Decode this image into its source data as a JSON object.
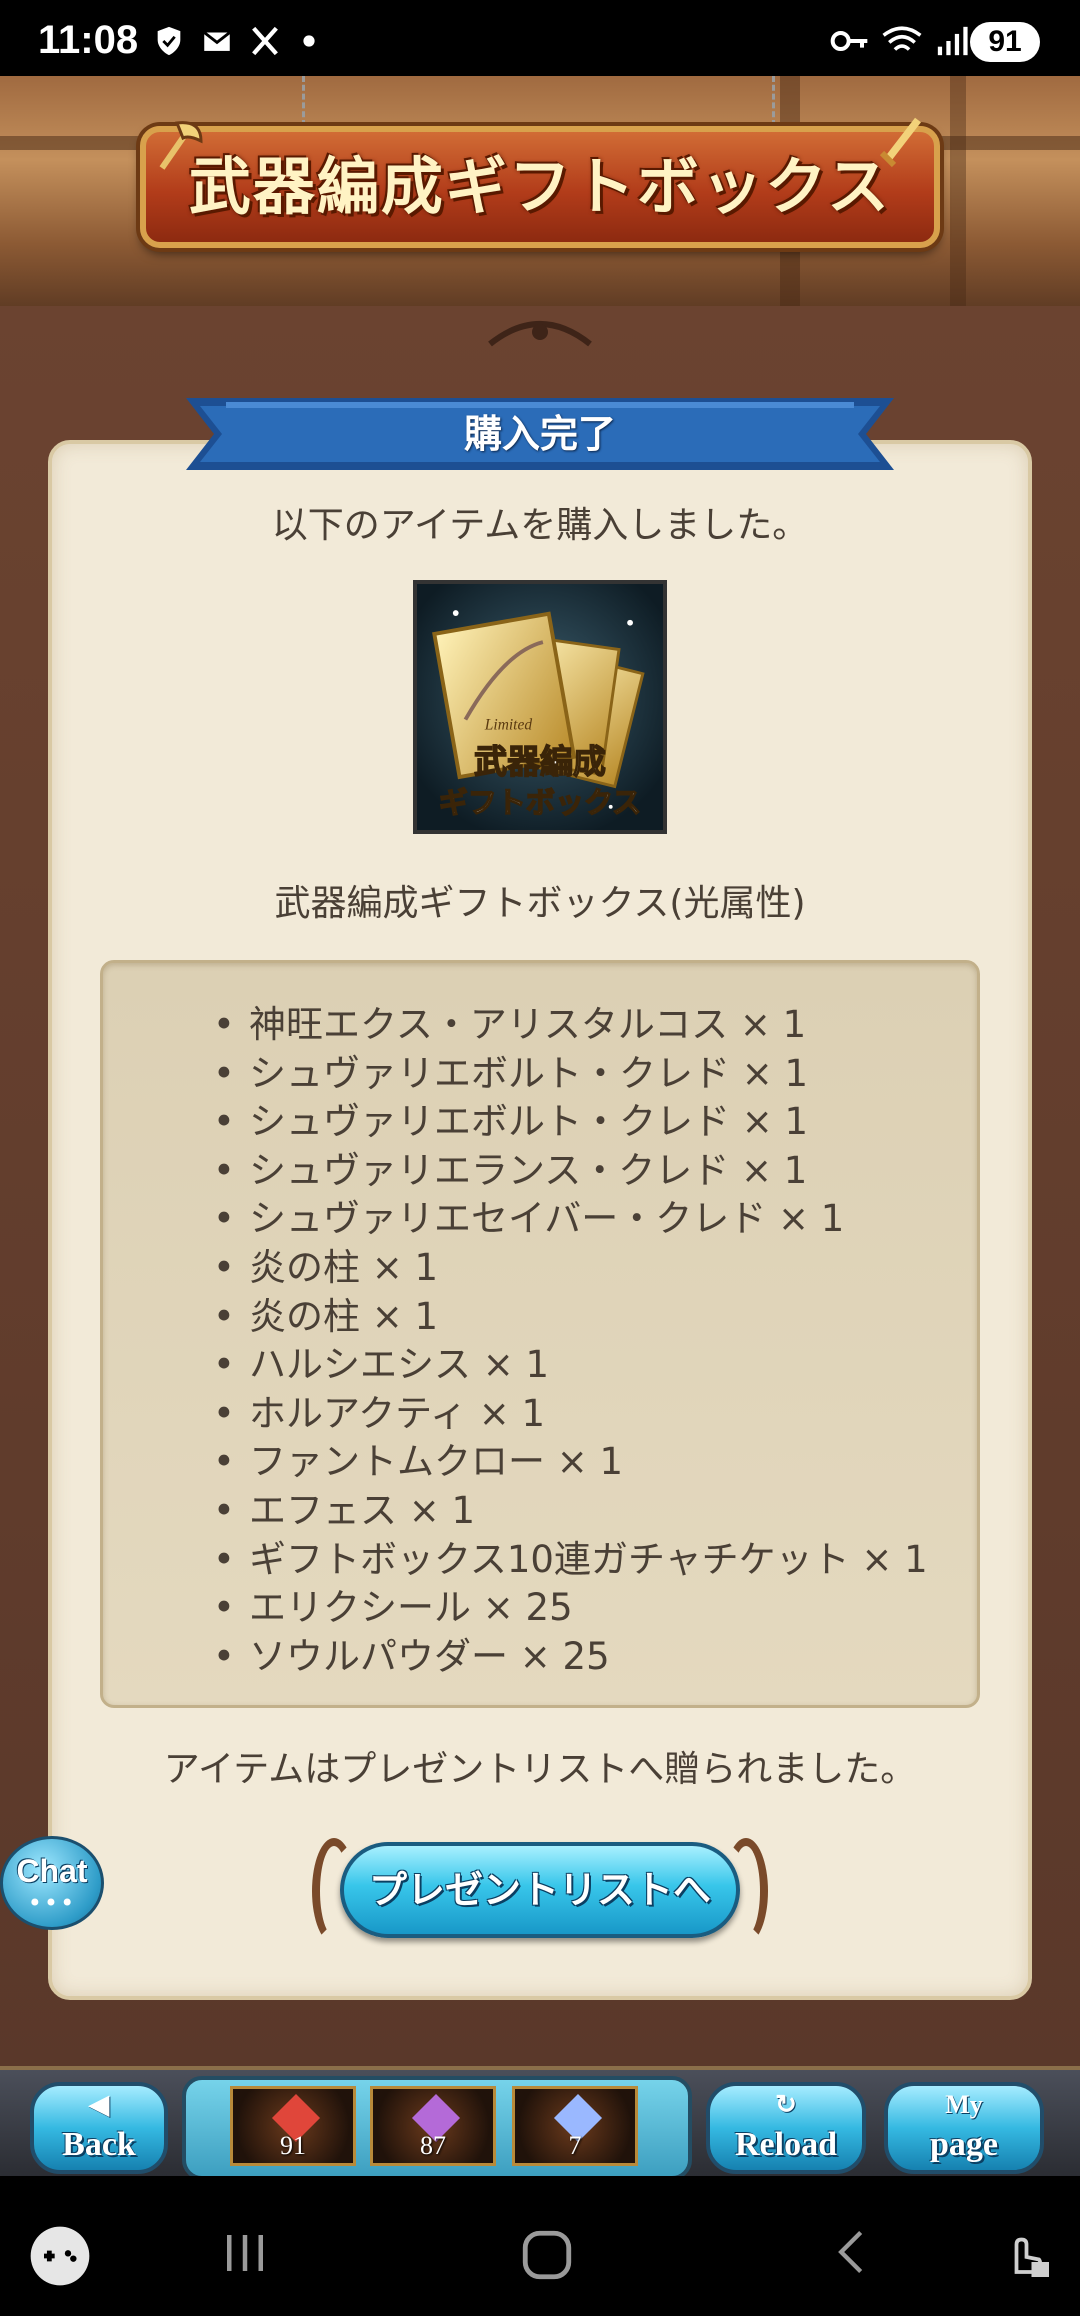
{
  "status_bar": {
    "time": "11:08",
    "battery": "91"
  },
  "banner": {
    "title": "武器編成ギフトボックス"
  },
  "dialog": {
    "header": "購入完了",
    "message_top": "以下のアイテムを購入しました。",
    "item_image_caption_line1": "武器編成",
    "item_image_caption_line2": "ギフトボックス",
    "item_image_badge": "Limited",
    "item_name": "武器編成ギフトボックス(光属性)",
    "contents": [
      "神旺エクス・アリスタルコス × 1",
      "シュヴァリエボルト・クレド × 1",
      "シュヴァリエボルト・クレド × 1",
      "シュヴァリエランス・クレド × 1",
      "シュヴァリエセイバー・クレド × 1",
      "炎の柱 × 1",
      "炎の柱 × 1",
      "ハルシエシス × 1",
      "ホルアクティ × 1",
      "ファントムクロー × 1",
      "エフェス × 1",
      "ギフトボックス10連ガチャチケット × 1",
      "エリクシール × 25",
      "ソウルパウダー × 25"
    ],
    "message_bottom": "アイテムはプレゼントリストへ贈られました。",
    "present_button": "プレゼントリストへ"
  },
  "chat": {
    "label": "Chat",
    "dots": "•••"
  },
  "game_nav": {
    "back": "Back",
    "reload": "Reload",
    "mypage_top": "My",
    "mypage_bottom": "page",
    "resources": [
      {
        "icon": "red-crystal-icon",
        "count": "91",
        "color": "#e0463a"
      },
      {
        "icon": "purple-crystal-icon",
        "count": "87",
        "color": "#b46ad8"
      },
      {
        "icon": "blue-crystal-icon",
        "count": "7",
        "color": "#9ab8ff"
      }
    ]
  }
}
